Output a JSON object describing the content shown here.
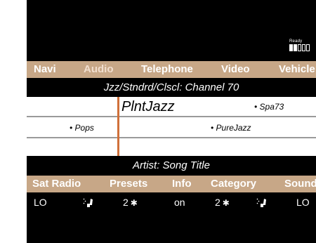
{
  "status": {
    "ready_label": "Ready",
    "signal_bars_total": 5,
    "signal_bars_filled": 2
  },
  "top_tabs": [
    {
      "label": "Navi",
      "active": false
    },
    {
      "label": "Audio",
      "active": true
    },
    {
      "label": "Telephone",
      "active": false
    },
    {
      "label": "Video",
      "active": false
    },
    {
      "label": "Vehicle",
      "active": false
    }
  ],
  "source_title": "Jzz/Stndrd/Clscl: Channel 70",
  "station_list": {
    "current": "PlntJazz",
    "items": [
      {
        "label": "• Spa73"
      },
      {
        "label": "• Pops"
      },
      {
        "label": "• PureJazz"
      }
    ]
  },
  "track_title": "Artist: Song Title",
  "bottom_tabs": [
    {
      "label": "Sat Radio"
    },
    {
      "label": "Presets"
    },
    {
      "label": "Info"
    },
    {
      "label": "Category"
    },
    {
      "label": "Sound"
    }
  ],
  "settings": [
    {
      "value": "LO",
      "icon": "none"
    },
    {
      "value": "",
      "icon": "seat-heat-icon"
    },
    {
      "value": "2",
      "icon": "fan-icon"
    },
    {
      "value": "on",
      "icon": "none"
    },
    {
      "value": "2",
      "icon": "fan-icon"
    },
    {
      "value": "",
      "icon": "seat-heat-icon"
    },
    {
      "value": "LO",
      "icon": "none"
    }
  ]
}
